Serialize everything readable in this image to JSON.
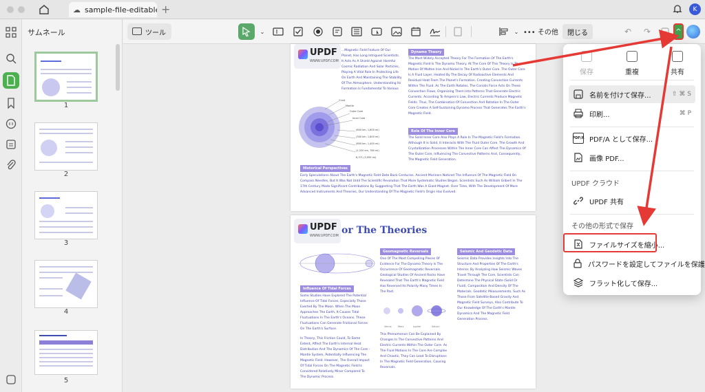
{
  "window": {
    "tab_title": "sample-file-editable",
    "tab_add": "+",
    "avatar_initial": "K"
  },
  "thumbnails": {
    "title": "サムネール",
    "pages": [
      "1",
      "2",
      "3",
      "4",
      "5"
    ]
  },
  "toolbar": {
    "tool_label": "ツール",
    "more_label": "その他",
    "close_label": "閉じる",
    "accent_color": "#5aa86a"
  },
  "pages": {
    "page1": {
      "logo_text": "UPDF",
      "logo_sub": "WWW.UPDF.COM",
      "badge_dynamo": "Dynamo Theory",
      "badge_inner_core": "Role Of The Inner Core",
      "badge_historical": "Historical Perspectives",
      "text_intro": "...Magnetic Field Feature Of Our Planet, Has Long Intrigued Scientists. It Acts As A Shield Against Harmful Cosmic Radiation And Solar Particles, Playing A Vital Role In Protecting Life On Earth And Maintaining The Stability Of The Atmosphere. Understanding Its Formation Is Fundamental To Various Scientific Disciplines, From Geophysics To Astrobiology.",
      "text_dynamo": "The Most Widely Accepted Theory For The Formation Of The Earth's Magnetic Field Is The Dynamo Theory. At The Core Of This Theory Is The Motion Of Molten Iron And Nickel In The Earth's Outer Core. The Outer Core Is A Fluid Layer, Heated By The Decay Of Radioactive Elements And Residual Heat From The Planet's Formation. Creating Convection Currents Within The Fluid. As The Earth Rotates, The Coriolis Force Acts On These Convection Flows, Organizing Them Into Patterns That Generate Electric Currents. According To Ampere's Law, Electric Currents Produce Magnetic Fields. Thus, The Combination Of Convection And Rotation In The Outer Core Creates A Self-Sustaining Dynamo Process That Generates The Earth's Magnetic Field.",
      "text_inner_core": "The Solid Inner Core Also Plays A Role In The Magnetic Field's Formation. Although It Is Solid, It Interacts With The Fluid Outer Core. The Growth And Crystallization Processes Within The Inner Core Can Affect The Dynamics Of The Outer Core, Influencing The Convective Patterns And, Consequently, The Magnetic Field Generation.",
      "text_historical": "Early Speculations About The Earth's Magnetic Field Date Back Centuries. Ancient Mariners Noticed The Influence Of The Magnetic Field On Compass Needles, But It Was Not Until The Scientific Revolution That More Systematic Studies Began. Scientists Such As William Gilbert In The 17th Century Made Significant Contributions By Suggesting That The Earth Was A Giant Magnet. Over Time, With The Development Of More Advanced Instruments And Theories, Our Understanding Of The Magnetic Field's Origin Has Evolved.",
      "diagram_labels": [
        "Crust",
        "Mantle",
        "Outer Core",
        "Inner Core",
        "(600 km, 1,800 mi)",
        "(300 km, 1,800 mi)",
        "(600 km, 1,400 mi)",
        "(1,220 km, 760 mi)",
        "6,371 (3,959 mi)"
      ]
    },
    "page2": {
      "logo_text": "UPDF",
      "logo_sub": "WWW.UPDF.COM",
      "title": "or The Theories",
      "badge_geomagnetic": "Geomagnetic Reversals",
      "badge_seismic": "Seismic And Geodetic Data",
      "badge_tidal": "Influence Of Tidal Forces",
      "text_geomagnetic": "One Of The Most Compelling Pieces Of Evidence For The Dynamo Theory Is The Occurrence Of Geomagnetic Reversals. Geological Studies Of Ancient Rocks Have Revealed That The Earth's Magnetic Field Has Reversed Its Polarity Many Times In The Past.",
      "text_seismic": "Seismic Data Provides Insights Into The Structure And Properties Of The Earth's Interior. By Analyzing How Seismic Waves Travel Through The Core, Scientists Can Determine The Physical State (Solid Or Fluid), Composition And Density Of The Materials. Geodetic Measurements, Such As Those From Satellite-Based Gravity And Magnetic Field Surveys, Also Contribute To Our Knowledge Of The Earth's Mantle Dynamics And The Magnetic Field Generation Process.",
      "text_tidal": "Some Studies Have Explored The Potential Influence Of Tidal Forces, Especially Those Exerted By The Moon. When The Moon Approaches The Earth, It Causes Tidal Fluctuations In The Earth's Oceans. These Fluctuations Can Generate Frictional Forces On The Earth's Surface.",
      "text_friction": "In Theory, This Friction Could, To Some Extent, Affect The Earth's Internal Heat Distribution And The Dynamics Of The Core - Mantle System, Potentially Influencing The Magnetic Field. However, The Overall Impact Of Tidal Forces On The Magnetic Field Is Considered Relatively Minor Compared To The Dynamic Process.",
      "text_reversal": "This Phenomenon Can Be Explained By Changes In The Convective Patterns And Electric Currents Within The Outer Core. As The Fluid Motions In The Core Are Complex And Chaotic, They Can Lead To Disruptions In The Magnetic Field Generation, Causing Reversals.",
      "planet_labels": [
        "Venus",
        "Mars",
        "Jupiter",
        "Saturn"
      ]
    }
  },
  "menu": {
    "top_items": [
      {
        "label": "保存",
        "icon": "save-icon",
        "enabled": false
      },
      {
        "label": "重複",
        "icon": "duplicate-icon",
        "enabled": true
      },
      {
        "label": "共有",
        "icon": "share-icon",
        "enabled": true
      }
    ],
    "save_as": {
      "label": "名前を付けて保存...",
      "shortcut": "⇧ ⌘ S"
    },
    "print": {
      "label": "印刷...",
      "shortcut": "⌘ P"
    },
    "pdfa": {
      "label": "PDF/A として保存...",
      "icon_text": "PDF/A"
    },
    "image_pdf": {
      "label": "画像 PDF..."
    },
    "section_cloud": "UPDF クラウド",
    "share_cloud": {
      "label": "UPDF 共有"
    },
    "section_other": "その他の形式で保存",
    "compress": {
      "label": "ファイルサイズを縮小..."
    },
    "password": {
      "label": "パスワードを設定してファイルを保護する..."
    },
    "flatten": {
      "label": "フラット化して保存..."
    },
    "highlight_color": "#e53935"
  }
}
